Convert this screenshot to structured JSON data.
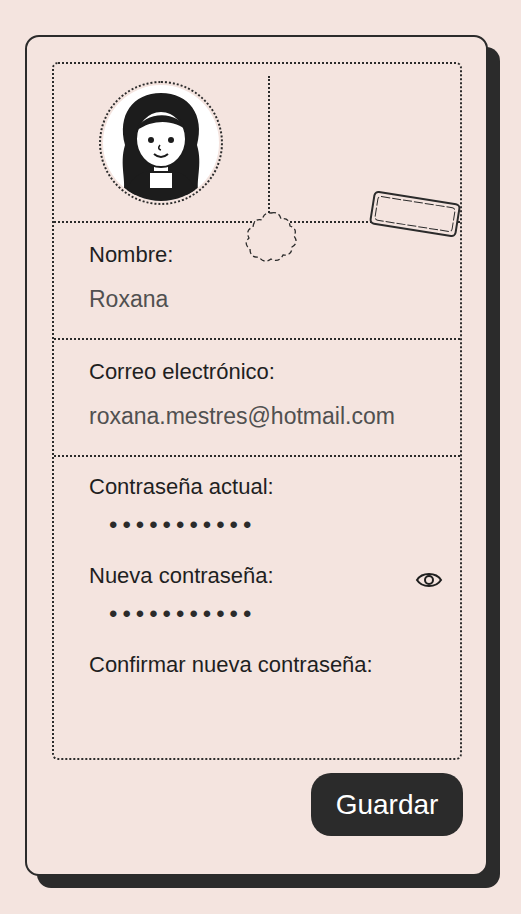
{
  "profile_fields": [
    {
      "label": "Nombre:",
      "value": "Roxana"
    },
    {
      "label": "Correo electrónico:",
      "value": "roxana.mestres@hotmail.com"
    }
  ],
  "password_fields": [
    {
      "label": "Contraseña actual:",
      "value": "•••••••••••",
      "show_toggle": false
    },
    {
      "label": "Nueva contraseña:",
      "value": "•••••••••••",
      "show_toggle": true
    },
    {
      "label": "Confirmar nueva contraseña:",
      "value": "",
      "show_toggle": false
    }
  ],
  "buttons": [
    "Guardar"
  ]
}
